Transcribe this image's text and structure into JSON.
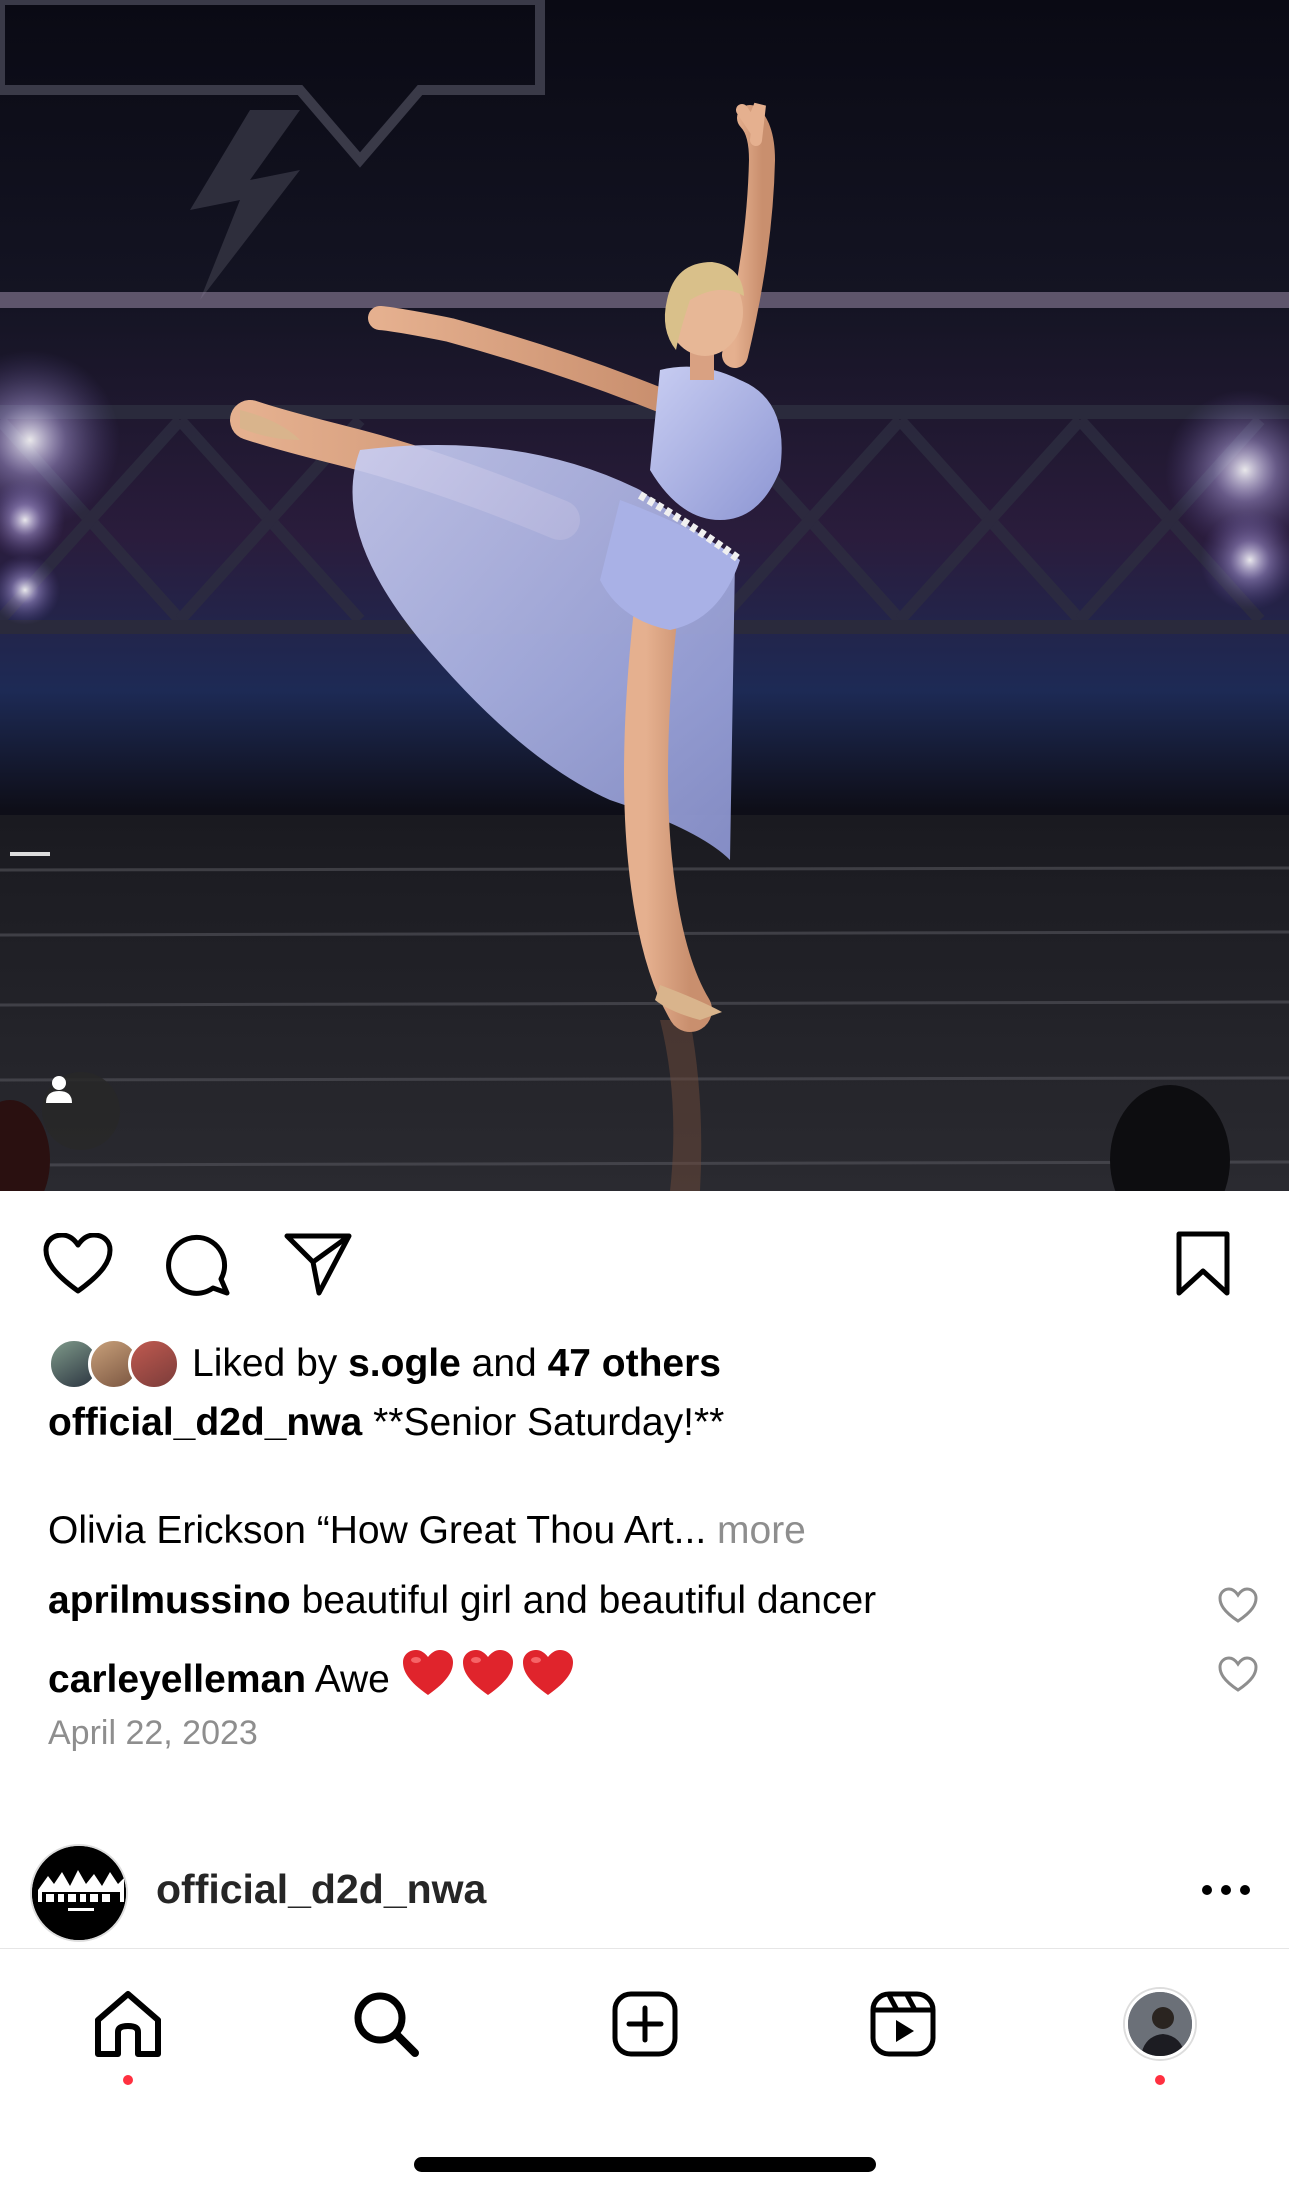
{
  "post": {
    "photo_alt": "",
    "actions": {
      "like_icon": "heart-icon",
      "comment_icon": "comment-icon",
      "share_icon": "share-icon",
      "save_icon": "bookmark-icon"
    },
    "likes": {
      "prefix": "Liked by",
      "first_user": "s.ogle",
      "and": "and",
      "others": "47 others"
    },
    "caption": {
      "username": "official_d2d_nwa",
      "text": "**Senior Saturday!**",
      "second_line": "Olivia Erickson “How Great Thou Art...",
      "more_label": "more"
    },
    "comments": [
      {
        "username": "aprilmussino",
        "text": "beautiful girl and beautiful dancer"
      },
      {
        "username": "carleyelleman",
        "text": "Awe"
      }
    ],
    "date": "April 22, 2023"
  },
  "next_post": {
    "username": "official_d2d_nwa",
    "more_icon": "more-icon"
  },
  "tabbar": {
    "items": [
      "home-icon",
      "search-icon",
      "create-icon",
      "reels-icon",
      "profile-avatar"
    ]
  },
  "colors": {
    "notification_dot": "#ff3040",
    "muted_text": "#8e8e8e",
    "heart_emoji": "#e0242c"
  }
}
